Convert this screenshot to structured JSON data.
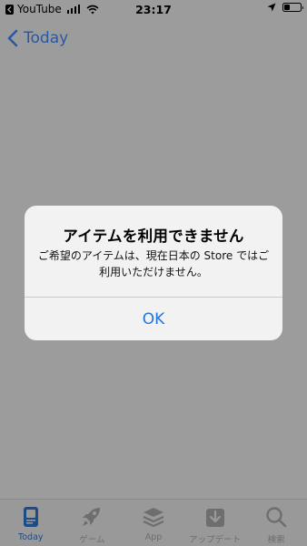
{
  "status_bar": {
    "back_app": "YouTube",
    "time": "23:17",
    "battery_level": 0.35,
    "signal_bars": 4
  },
  "nav": {
    "back_label": "Today"
  },
  "alert": {
    "title": "アイテムを利用できません",
    "message": "ご希望のアイテムは、現在日本の Store ではご利用いただけません。",
    "ok_label": "OK"
  },
  "tab_bar": {
    "items": [
      {
        "label": "Today",
        "icon": "today-icon",
        "active": true
      },
      {
        "label": "ゲーム",
        "icon": "rocket-icon",
        "active": false
      },
      {
        "label": "App",
        "icon": "app-stack-icon",
        "active": false
      },
      {
        "label": "アップデート",
        "icon": "update-download-icon",
        "active": false
      },
      {
        "label": "検索",
        "icon": "search-icon",
        "active": false
      }
    ]
  },
  "colors": {
    "accent": "#1f74e0",
    "nav_link": "#2a58a3",
    "tab_active": "#1e4a86",
    "dim_background": "#9c9c9c"
  }
}
